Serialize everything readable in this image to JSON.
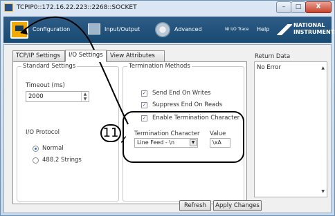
{
  "window": {
    "title": "TCPIP0::172.16.22.223::2268::SOCKET"
  },
  "window_controls": {
    "minimize": "–",
    "maximize": "□",
    "close": "X"
  },
  "toolbar": {
    "configuration": "Configuration",
    "input_output": "Input/Output",
    "advanced": "Advanced",
    "ni_io_trace": "NI I/O Trace",
    "help": "Help",
    "logo_line1": "NATIONAL",
    "logo_line2": "INSTRUMENTS"
  },
  "tabs": [
    {
      "label": "TCP/IP Settings"
    },
    {
      "label": "I/O Settings",
      "selected": true
    },
    {
      "label": "View Attributes"
    }
  ],
  "standard_settings": {
    "title": "Standard Settings",
    "timeout_label": "Timeout (ms)",
    "timeout_value": "2000",
    "io_protocol_label": "I/O Protocol",
    "options": [
      {
        "label": "Normal",
        "selected": true
      },
      {
        "label": "488.2 Strings",
        "selected": false
      }
    ]
  },
  "termination_methods": {
    "title": "Termination Methods",
    "checks": [
      {
        "label": "Send End On Writes",
        "checked": true
      },
      {
        "label": "Suppress End On Reads",
        "checked": true
      },
      {
        "label": "Enable Termination Character",
        "checked": true
      }
    ],
    "term_char_label": "Termination Character",
    "term_char_value": "Line Feed - \\n",
    "value_label": "Value",
    "value_value": "\\xA"
  },
  "return_data": {
    "label": "Return Data",
    "value": "No Error"
  },
  "buttons": {
    "refresh": "Refresh",
    "apply": "Apply Changes"
  },
  "callout": {
    "number": "11"
  }
}
